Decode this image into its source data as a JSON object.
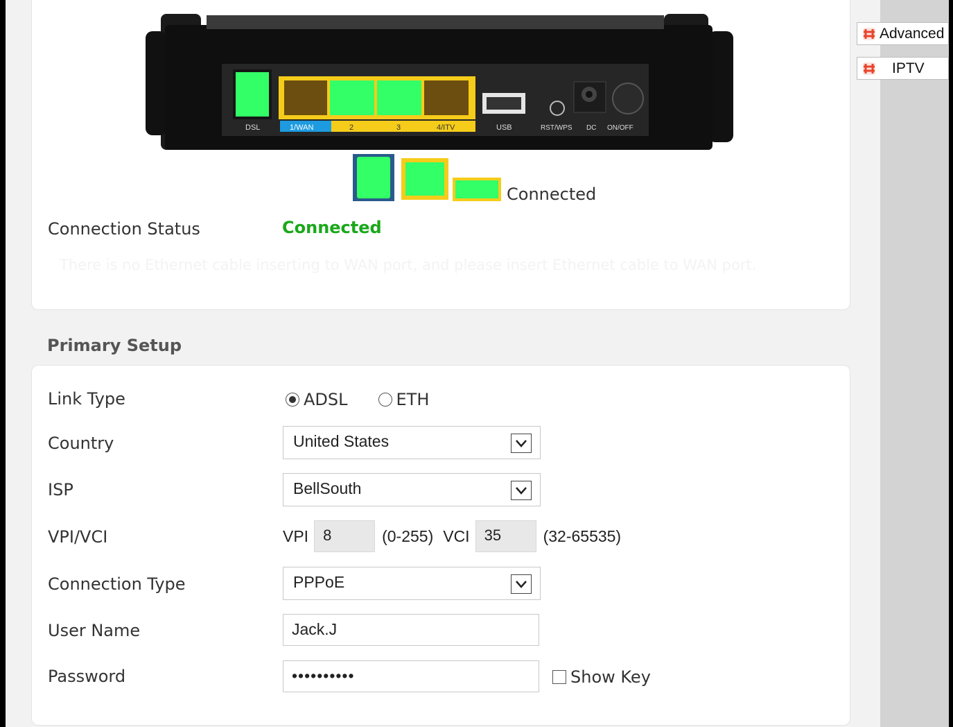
{
  "status_section": {
    "legend_connected": "Connected",
    "connection_status_label": "Connection Status",
    "connection_status_value": "Connected",
    "hint_text": "There is no Ethernet cable inserting to WAN port, and please insert Ethernet cable to WAN port.",
    "port_labels": [
      "DSL",
      "1/WAN",
      "2",
      "3",
      "4/ITV",
      "USB",
      "RST/WPS",
      "DC",
      "ON/OFF"
    ]
  },
  "primary_setup": {
    "title": "Primary Setup",
    "link_type": {
      "label": "Link Type",
      "options": [
        "ADSL",
        "ETH"
      ],
      "selected": "ADSL"
    },
    "country": {
      "label": "Country",
      "value": "United States"
    },
    "isp": {
      "label": "ISP",
      "value": "BellSouth"
    },
    "vpi_vci": {
      "label": "VPI/VCI",
      "vpi_label": "VPI",
      "vpi_value": "8",
      "vpi_range": "(0-255)",
      "vci_label": "VCI",
      "vci_value": "35",
      "vci_range": "(32-65535)"
    },
    "connection_type": {
      "label": "Connection Type",
      "value": "PPPoE"
    },
    "user_name": {
      "label": "User Name",
      "value": "Jack.J"
    },
    "password": {
      "label": "Password",
      "value": "••••••••••",
      "show_key_label": "Show Key"
    }
  },
  "sidebar": {
    "buttons": [
      {
        "label": "Advanced",
        "icon": "gear-icon"
      },
      {
        "label": "IPTV",
        "icon": "gear-icon"
      }
    ]
  },
  "colors": {
    "connected_green": "#1aa81a",
    "port_green": "#33ff66",
    "port_yellow": "#f5cc1a",
    "wan_blue": "#1e9be0"
  }
}
